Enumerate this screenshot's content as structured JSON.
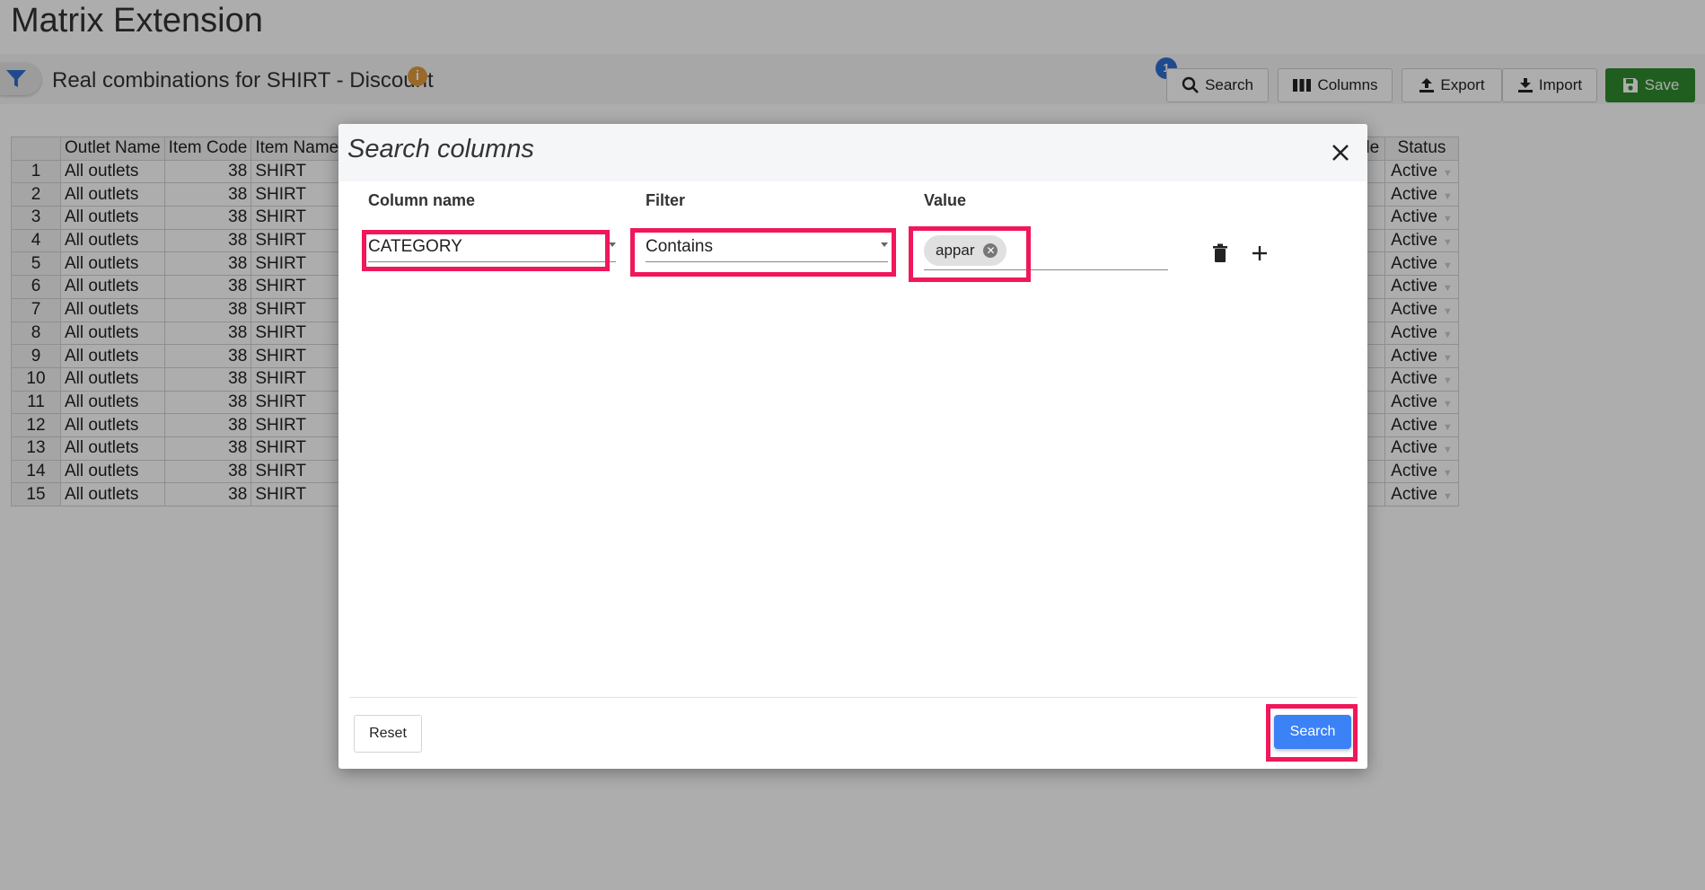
{
  "app": {
    "title": "Matrix Extension"
  },
  "header": {
    "subtitle": "Real combinations for SHIRT - Discount",
    "info_symbol": "i"
  },
  "toolbar": {
    "search_badge": "1",
    "search_label": "Search",
    "columns_label": "Columns",
    "export_label": "Export",
    "import_label": "Import",
    "save_label": "Save"
  },
  "grid": {
    "headers": [
      "",
      "Outlet Name",
      "Item Code",
      "Item Name"
    ],
    "status_header_prefix": "de",
    "status_header": "Status",
    "rows": [
      {
        "n": "1",
        "outlet": "All outlets",
        "code": "38",
        "name": "SHIRT",
        "status": "Active"
      },
      {
        "n": "2",
        "outlet": "All outlets",
        "code": "38",
        "name": "SHIRT",
        "status": "Active"
      },
      {
        "n": "3",
        "outlet": "All outlets",
        "code": "38",
        "name": "SHIRT",
        "status": "Active"
      },
      {
        "n": "4",
        "outlet": "All outlets",
        "code": "38",
        "name": "SHIRT",
        "status": "Active"
      },
      {
        "n": "5",
        "outlet": "All outlets",
        "code": "38",
        "name": "SHIRT",
        "status": "Active"
      },
      {
        "n": "6",
        "outlet": "All outlets",
        "code": "38",
        "name": "SHIRT",
        "status": "Active"
      },
      {
        "n": "7",
        "outlet": "All outlets",
        "code": "38",
        "name": "SHIRT",
        "status": "Active"
      },
      {
        "n": "8",
        "outlet": "All outlets",
        "code": "38",
        "name": "SHIRT",
        "status": "Active"
      },
      {
        "n": "9",
        "outlet": "All outlets",
        "code": "38",
        "name": "SHIRT",
        "status": "Active"
      },
      {
        "n": "10",
        "outlet": "All outlets",
        "code": "38",
        "name": "SHIRT",
        "status": "Active"
      },
      {
        "n": "11",
        "outlet": "All outlets",
        "code": "38",
        "name": "SHIRT",
        "status": "Active"
      },
      {
        "n": "12",
        "outlet": "All outlets",
        "code": "38",
        "name": "SHIRT",
        "status": "Active"
      },
      {
        "n": "13",
        "outlet": "All outlets",
        "code": "38",
        "name": "SHIRT",
        "status": "Active"
      },
      {
        "n": "14",
        "outlet": "All outlets",
        "code": "38",
        "name": "SHIRT",
        "status": "Active"
      },
      {
        "n": "15",
        "outlet": "All outlets",
        "code": "38",
        "name": "SHIRT",
        "status": "Active"
      }
    ]
  },
  "modal": {
    "title": "Search columns",
    "column_name_header": "Column name",
    "filter_header": "Filter",
    "value_header": "Value",
    "column_value": "CATEGORY",
    "filter_value": "Contains",
    "value_chip": "appar",
    "reset_label": "Reset",
    "search_label": "Search"
  },
  "colors": {
    "highlight": "#f0175a",
    "primary": "#3b82f6",
    "save": "#2e8b2e",
    "info": "#e29b3d",
    "badge": "#2f6fd2"
  },
  "icons": [
    "filter-icon",
    "info-icon",
    "search-icon",
    "columns-icon",
    "export-icon",
    "import-icon",
    "save-icon",
    "close-icon",
    "trash-icon",
    "plus-icon",
    "chip-remove-icon"
  ]
}
